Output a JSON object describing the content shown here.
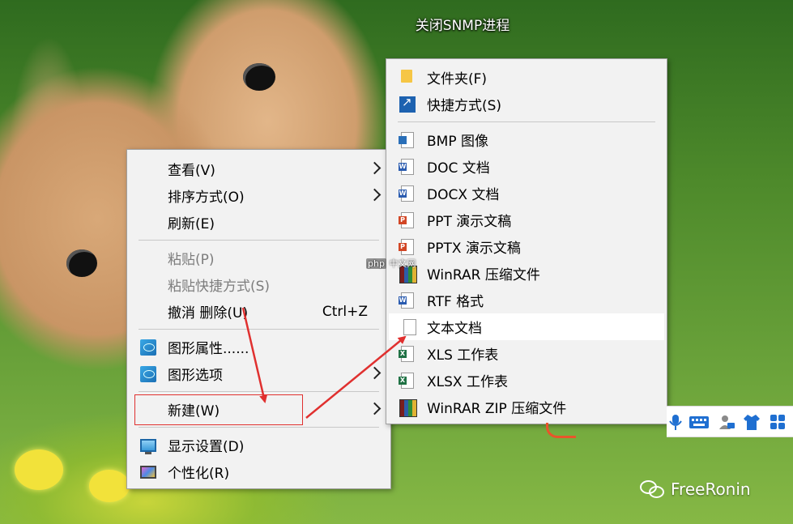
{
  "desktop_icon": {
    "label": "关闭SNMP进程"
  },
  "context_menu": {
    "items": [
      {
        "label": "查看(V)",
        "submenu": true
      },
      {
        "label": "排序方式(O)",
        "submenu": true
      },
      {
        "label": "刷新(E)"
      },
      {
        "label": "粘贴(P)",
        "disabled": true
      },
      {
        "label": "粘贴快捷方式(S)",
        "disabled": true
      },
      {
        "label": "撤消 删除(U)",
        "shortcut": "Ctrl+Z"
      },
      {
        "label": "图形属性......",
        "icon": "intel-graphics-icon"
      },
      {
        "label": "图形选项",
        "icon": "intel-graphics-icon",
        "submenu": true
      },
      {
        "label": "新建(W)",
        "submenu": true,
        "annotated": true
      },
      {
        "label": "显示设置(D)",
        "icon": "display-settings-icon"
      },
      {
        "label": "个性化(R)",
        "icon": "personalize-icon"
      }
    ]
  },
  "new_submenu": {
    "items": [
      {
        "label": "文件夹(F)",
        "icon": "folder-icon"
      },
      {
        "label": "快捷方式(S)",
        "icon": "shortcut-icon"
      },
      {
        "label": "BMP 图像",
        "icon": "bmp-image-icon"
      },
      {
        "label": "DOC 文档",
        "icon": "word-doc-icon"
      },
      {
        "label": "DOCX 文档",
        "icon": "word-docx-icon"
      },
      {
        "label": "PPT 演示文稿",
        "icon": "ppt-icon"
      },
      {
        "label": "PPTX 演示文稿",
        "icon": "pptx-icon"
      },
      {
        "label": "WinRAR 压缩文件",
        "icon": "winrar-icon"
      },
      {
        "label": "RTF 格式",
        "icon": "rtf-icon"
      },
      {
        "label": "文本文档",
        "icon": "text-document-icon",
        "highlighted": true
      },
      {
        "label": "XLS 工作表",
        "icon": "xls-icon"
      },
      {
        "label": "XLSX 工作表",
        "icon": "xlsx-icon"
      },
      {
        "label": "WinRAR ZIP 压缩文件",
        "icon": "winrar-zip-icon"
      }
    ]
  },
  "watermark": {
    "site": "php",
    "cn": "中文网"
  },
  "brand": {
    "label": "FreeRonin",
    "icon": "wechat-icon"
  },
  "colors": {
    "annotation_red": "#e0302f",
    "menu_bg": "#f2f2f2",
    "highlight": "#ffffff"
  }
}
